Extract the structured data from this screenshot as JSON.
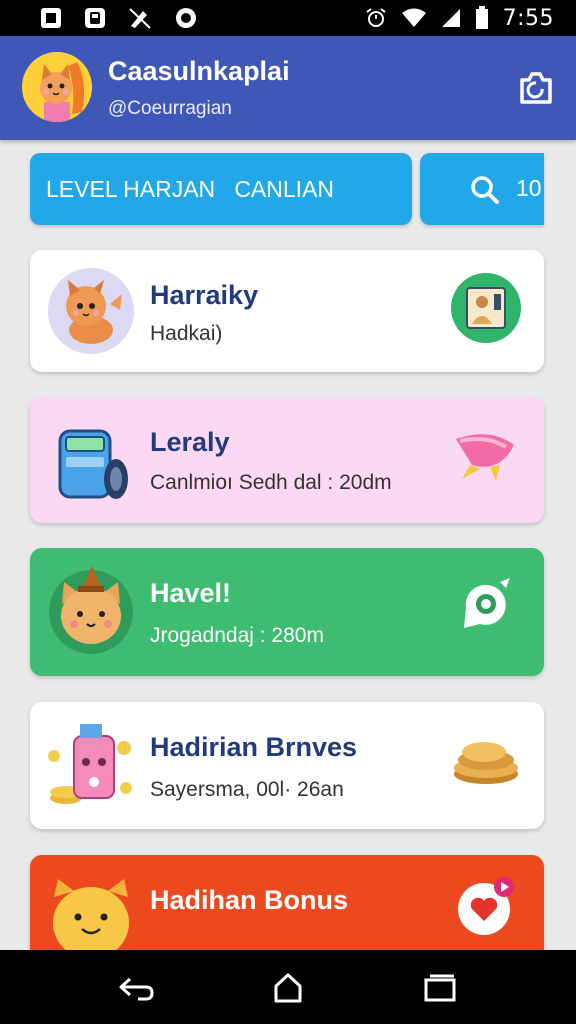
{
  "status_bar": {
    "time": "7:55",
    "icons": [
      "square-notification-icon",
      "box-notification-icon",
      "pencil-off-icon",
      "circle-notification-icon",
      "alarm-icon",
      "wifi-icon",
      "signal-icon",
      "battery-icon"
    ]
  },
  "header": {
    "title": "Caasulnkaplai",
    "subtitle": "@Coeurragian",
    "avatar": "cat-avatar",
    "action_icon": "camera-icon"
  },
  "actions": {
    "level_label": "LEVEL HARJAN   CANLIAN",
    "search_count": "10"
  },
  "cards": [
    {
      "title": "Harraiky",
      "subtitle": "Hadkai)",
      "icon": "cat-character-icon",
      "right_icon": "profile-card-icon",
      "bg": "#ffffff"
    },
    {
      "title": "Leraly",
      "subtitle": "Canlmioı Sedh dal : 20dm",
      "icon": "machine-icon",
      "right_icon": "pink-fish-icon",
      "bg": "#fbd9f4"
    },
    {
      "title": "Havel!",
      "subtitle": "Jrogadndaj : 280m",
      "icon": "cat-hat-icon",
      "right_icon": "eye-badge-icon",
      "bg": "#3ebd72"
    },
    {
      "title": "Hadirian Brnves",
      "subtitle": "Sayersma, 00l· 26an",
      "icon": "coin-phone-icon",
      "right_icon": "pancakes-icon",
      "bg": "#ffffff"
    },
    {
      "title": "Hadihan Bonus",
      "subtitle": "",
      "icon": "cat-mascot-icon",
      "right_icon": "heart-badge-icon",
      "bg": "#ec4a1e"
    }
  ],
  "colors": {
    "header": "#3f58b8",
    "accent": "#22a8e8",
    "green": "#3ebd72",
    "orange": "#ec4a1e",
    "pink": "#fbd9f4",
    "title_dark": "#233a7c"
  }
}
